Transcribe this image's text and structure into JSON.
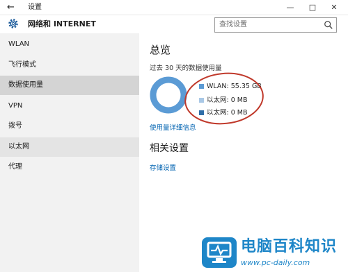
{
  "window": {
    "title": "设置",
    "minimize_glyph": "—",
    "maximize_glyph": "□",
    "close_glyph": "✕"
  },
  "header": {
    "title": "网络和 INTERNET",
    "search_placeholder": "查找设置"
  },
  "sidebar": {
    "items": [
      {
        "label": "WLAN"
      },
      {
        "label": "飞行模式"
      },
      {
        "label": "数据使用量"
      },
      {
        "label": "VPN"
      },
      {
        "label": "拨号"
      },
      {
        "label": "以太网"
      },
      {
        "label": "代理"
      }
    ],
    "selected_index": 2
  },
  "main": {
    "overview_title": "总览",
    "usage_subtitle": "过去 30 天的数据使用量",
    "legend": [
      {
        "label": "WLAN: 55.35 GB",
        "color": "#5b9bd5"
      },
      {
        "label": "以太网: 0 MB",
        "color": "#a9c8e6"
      },
      {
        "label": "以太网: 0 MB",
        "color": "#2f6ea8"
      }
    ],
    "usage_details_link": "使用量详细信息",
    "related_title": "相关设置",
    "storage_link": "存储设置"
  },
  "colors": {
    "accent": "#0063b1",
    "donut": "#5b9bd5",
    "annotation": "#c0392b",
    "sidebar_bg": "#f2f2f2"
  },
  "watermark": {
    "title": "电脑百科知识",
    "url": "www.pc-daily.com"
  }
}
